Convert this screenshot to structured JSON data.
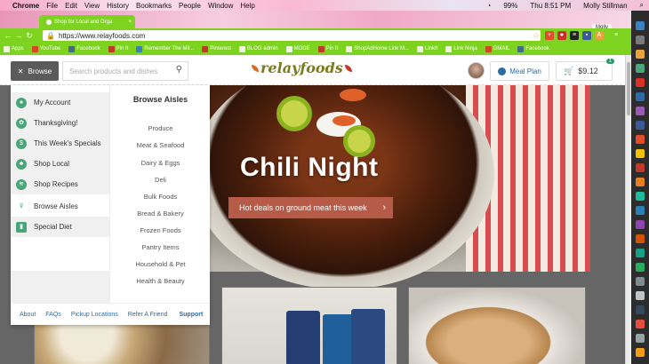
{
  "menubar": {
    "app": "Chrome",
    "items": [
      "File",
      "Edit",
      "View",
      "History",
      "Bookmarks",
      "People",
      "Window",
      "Help"
    ],
    "battery": "99%",
    "clock": "Thu 8:51 PM",
    "user": "Molly Stillman"
  },
  "tab": {
    "title": "Shop for Local and Orga",
    "profile": "Molly"
  },
  "urlbar": {
    "url": "https://www.relayfoods.com"
  },
  "bookmarks": [
    {
      "label": "Apps",
      "icon": "apps-icon"
    },
    {
      "label": "YouTube",
      "icon": "youtube-icon"
    },
    {
      "label": "Facebook",
      "icon": "facebook-icon"
    },
    {
      "label": "Pin It",
      "icon": "pinterest-icon"
    },
    {
      "label": "Remember The Mil...",
      "icon": "rtm-icon"
    },
    {
      "label": "Pinterest",
      "icon": "pinterest-icon"
    },
    {
      "label": "BLOG admin",
      "icon": "folder-icon"
    },
    {
      "label": "MODE",
      "icon": "folder-icon"
    },
    {
      "label": "Pin It",
      "icon": "pinterest-icon"
    },
    {
      "label": "ShopAdHome Link M...",
      "icon": "folder-icon"
    },
    {
      "label": "LinkIt",
      "icon": "link-icon"
    },
    {
      "label": "Link Ninja",
      "icon": "link-icon"
    },
    {
      "label": "GMAIL",
      "icon": "gmail-icon"
    },
    {
      "label": "Facebook",
      "icon": "facebook-icon"
    }
  ],
  "site": {
    "browse_label": "Browse",
    "search_placeholder": "Search products and dishes",
    "logo": "relayfoods",
    "meal_plan": "Meal Plan",
    "cart_total": "$9.12",
    "cart_count": "1"
  },
  "menu": {
    "left_items": [
      {
        "label": "My Account",
        "icon": "user-icon"
      },
      {
        "label": "Thanksgiving!",
        "icon": "turkey-icon"
      },
      {
        "label": "This Week's Specials",
        "icon": "dollar-icon"
      },
      {
        "label": "Shop Local",
        "icon": "local-icon"
      },
      {
        "label": "Shop Recipes",
        "icon": "recipes-icon"
      },
      {
        "label": "Browse Aisles",
        "icon": "aisles-icon"
      },
      {
        "label": "Special Diet",
        "icon": "diet-icon"
      }
    ],
    "aisles_title": "Browse Aisles",
    "aisles": [
      "Produce",
      "Meat & Seafood",
      "Dairy & Eggs",
      "Deli",
      "Bulk Foods",
      "Bread & Bakery",
      "Frozen Foods",
      "Pantry Items",
      "Household & Pet",
      "Health & Beauty"
    ],
    "footer": [
      "About",
      "FAQs",
      "Pickup Locations",
      "Refer A Friend",
      "Support"
    ]
  },
  "hero": {
    "title": "Chili Night",
    "cta": "Hot deals on ground meat this week"
  },
  "colors": {
    "chrome_green": "#7ed321",
    "cta_red": "#b65b47",
    "browse_gray": "#5b5b5b",
    "link_blue": "#2b6aa6"
  }
}
